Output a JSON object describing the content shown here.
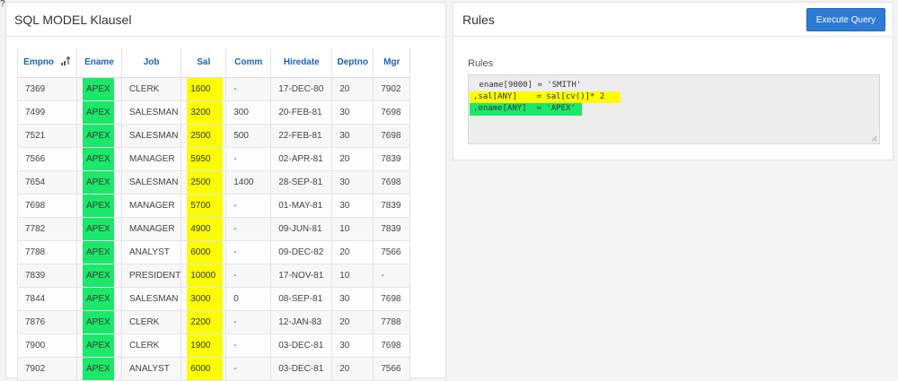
{
  "corner_mark": "?",
  "left_panel": {
    "title": "SQL MODEL Klausel",
    "columns": [
      "Empno",
      "Ename",
      "Job",
      "Sal",
      "Comm",
      "Hiredate",
      "Deptno",
      "Mgr"
    ],
    "rows": [
      [
        "7369",
        "APEX",
        "CLERK",
        "1600",
        "-",
        "17-DEC-80",
        "20",
        "7902"
      ],
      [
        "7499",
        "APEX",
        "SALESMAN",
        "3200",
        "300",
        "20-FEB-81",
        "30",
        "7698"
      ],
      [
        "7521",
        "APEX",
        "SALESMAN",
        "2500",
        "500",
        "22-FEB-81",
        "30",
        "7698"
      ],
      [
        "7566",
        "APEX",
        "MANAGER",
        "5950",
        "-",
        "02-APR-81",
        "20",
        "7839"
      ],
      [
        "7654",
        "APEX",
        "SALESMAN",
        "2500",
        "1400",
        "28-SEP-81",
        "30",
        "7698"
      ],
      [
        "7698",
        "APEX",
        "MANAGER",
        "5700",
        "-",
        "01-MAY-81",
        "30",
        "7839"
      ],
      [
        "7782",
        "APEX",
        "MANAGER",
        "4900",
        "-",
        "09-JUN-81",
        "10",
        "7839"
      ],
      [
        "7788",
        "APEX",
        "ANALYST",
        "6000",
        "-",
        "09-DEC-82",
        "20",
        "7566"
      ],
      [
        "7839",
        "APEX",
        "PRESIDENT",
        "10000",
        "-",
        "17-NOV-81",
        "10",
        "-"
      ],
      [
        "7844",
        "APEX",
        "SALESMAN",
        "3000",
        "0",
        "08-SEP-81",
        "30",
        "7698"
      ],
      [
        "7876",
        "APEX",
        "CLERK",
        "2200",
        "-",
        "12-JAN-83",
        "20",
        "7788"
      ],
      [
        "7900",
        "APEX",
        "CLERK",
        "1900",
        "-",
        "03-DEC-81",
        "30",
        "7698"
      ],
      [
        "7902",
        "APEX",
        "ANALYST",
        "6000",
        "-",
        "03-DEC-81",
        "20",
        "7566"
      ]
    ]
  },
  "right_panel": {
    "title": "Rules",
    "execute_button": "Execute Query",
    "rules_label": "Rules",
    "code_lines": [
      " ename[9000] = 'SMITH'",
      ",sal[ANY]    = sal[cv()]* 2",
      ",ename[ANY]  = 'APEX'"
    ]
  },
  "colors": {
    "highlight_green": "#1be86a",
    "highlight_yellow": "#fcfc00",
    "header_link": "#1a65b4",
    "button": "#2d7bd4"
  },
  "icons": {
    "sort": "sort-ascending-icon"
  }
}
